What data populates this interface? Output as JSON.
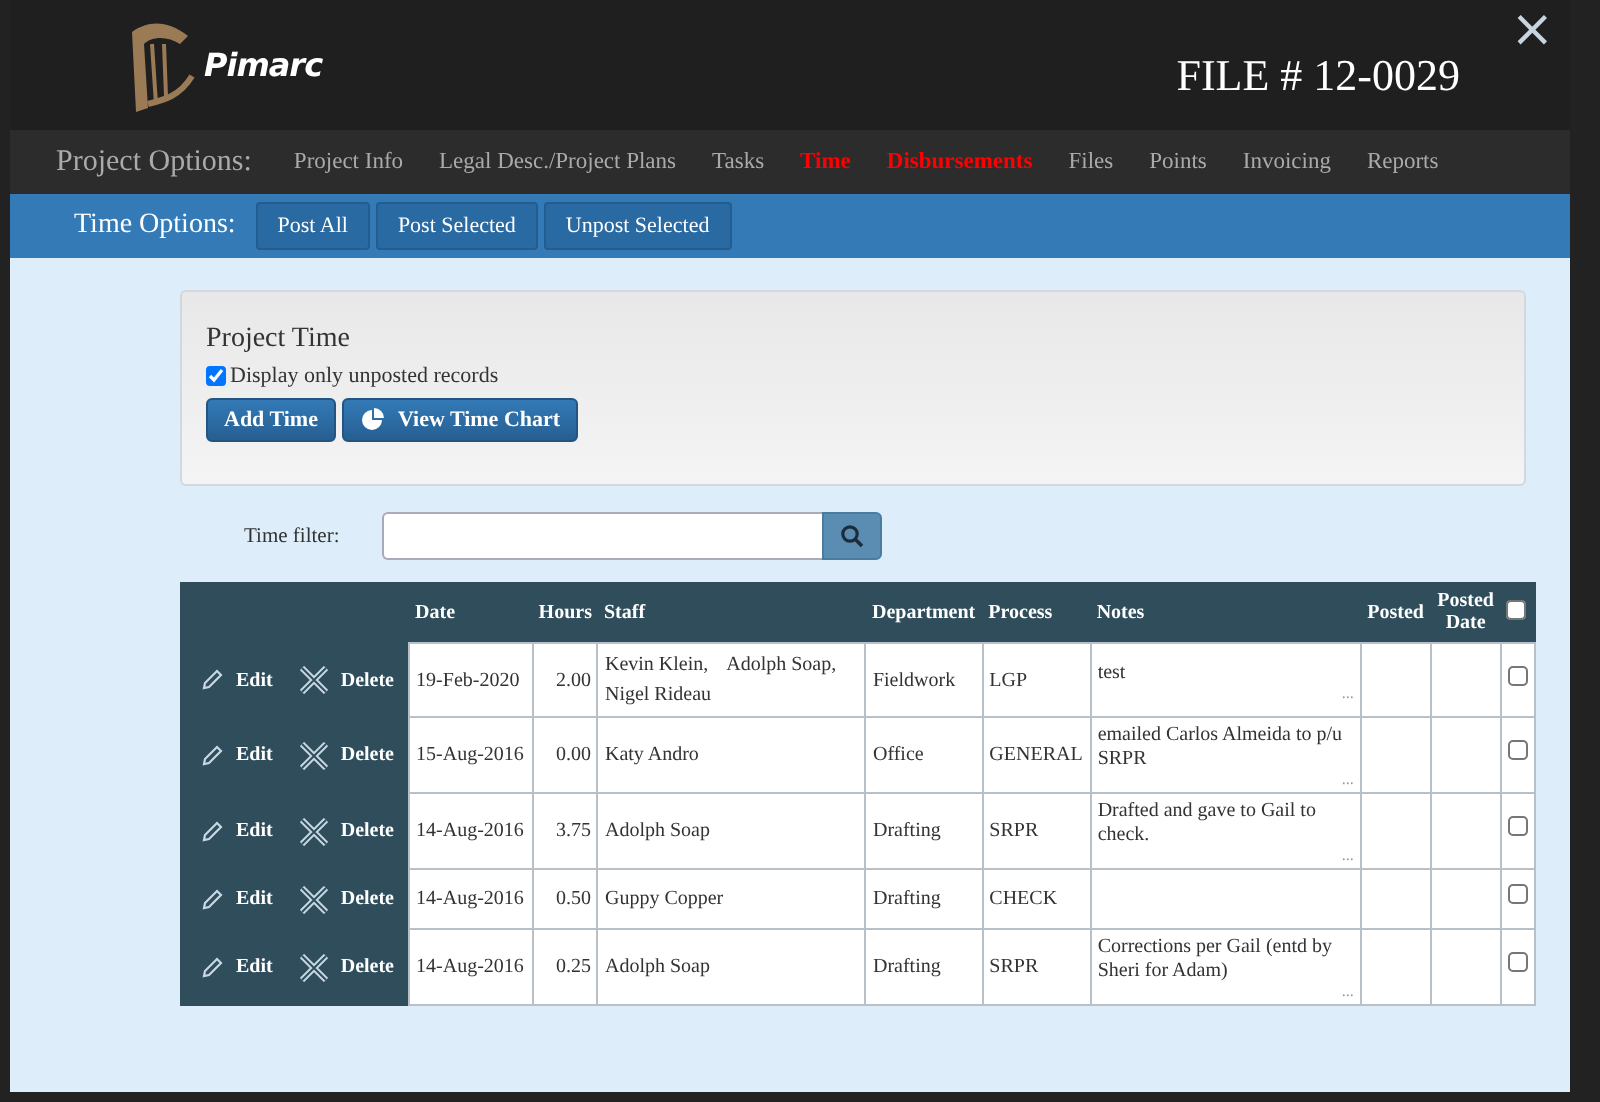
{
  "header": {
    "brand": "Pimarc",
    "file_title": "FILE # 12-0029",
    "close": "×"
  },
  "project_options": {
    "label": "Project Options:",
    "items": [
      {
        "label": "Project Info",
        "highlighted": false
      },
      {
        "label": "Legal Desc./Project Plans",
        "highlighted": false
      },
      {
        "label": "Tasks",
        "highlighted": false
      },
      {
        "label": "Time",
        "highlighted": true
      },
      {
        "label": "Disbursements",
        "highlighted": true
      },
      {
        "label": "Files",
        "highlighted": false
      },
      {
        "label": "Points",
        "highlighted": false
      },
      {
        "label": "Invoicing",
        "highlighted": false
      },
      {
        "label": "Reports",
        "highlighted": false
      }
    ]
  },
  "time_options": {
    "label": "Time Options:",
    "buttons": [
      "Post All",
      "Post Selected",
      "Unpost Selected"
    ]
  },
  "project_time": {
    "title": "Project Time",
    "unposted_only": {
      "label": "Display only unposted records",
      "checked": true
    },
    "buttons": [
      {
        "label": "Add Time",
        "kind": "plain"
      },
      {
        "label": "View Time Chart",
        "kind": "chart"
      }
    ]
  },
  "filter": {
    "label": "Time filter:"
  },
  "table": {
    "columns": [
      "Date",
      "Hours",
      "Staff",
      "Department",
      "Process",
      "Notes",
      "Posted",
      "Posted Date"
    ],
    "select_all": false,
    "rows": [
      {
        "edit": "Edit",
        "delete": "Delete",
        "date": "19-Feb-2020",
        "hours": "2.00",
        "staff": [
          "Kevin Klein,",
          "Adolph Soap,",
          "Nigel Rideau"
        ],
        "department": "Fieldwork",
        "process": "LGP",
        "notes": "test",
        "more": "...",
        "checked": false
      },
      {
        "edit": "Edit",
        "delete": "Delete",
        "date": "15-Aug-2016",
        "hours": "0.00",
        "staff": [
          "Katy Andro"
        ],
        "department": "Office",
        "process": "GENERAL",
        "notes": "emailed Carlos Almeida to p/u SRPR",
        "more": "...",
        "checked": false
      },
      {
        "edit": "Edit",
        "delete": "Delete",
        "date": "14-Aug-2016",
        "hours": "3.75",
        "staff": [
          "Adolph Soap"
        ],
        "department": "Drafting",
        "process": "SRPR",
        "notes": "Drafted and gave to Gail to check.",
        "more": "...",
        "checked": false
      },
      {
        "edit": "Edit",
        "delete": "Delete",
        "date": "14-Aug-2016",
        "hours": "0.50",
        "staff": [
          "Guppy Copper"
        ],
        "department": "Drafting",
        "process": "CHECK",
        "checked": false
      },
      {
        "edit": "Edit",
        "delete": "Delete",
        "date": "14-Aug-2016",
        "hours": "0.25",
        "staff": [
          "Adolph Soap"
        ],
        "department": "Drafting",
        "process": "SRPR",
        "notes": "Corrections per Gail (entd by Sheri for Adam)",
        "more": "...",
        "checked": false
      }
    ]
  }
}
